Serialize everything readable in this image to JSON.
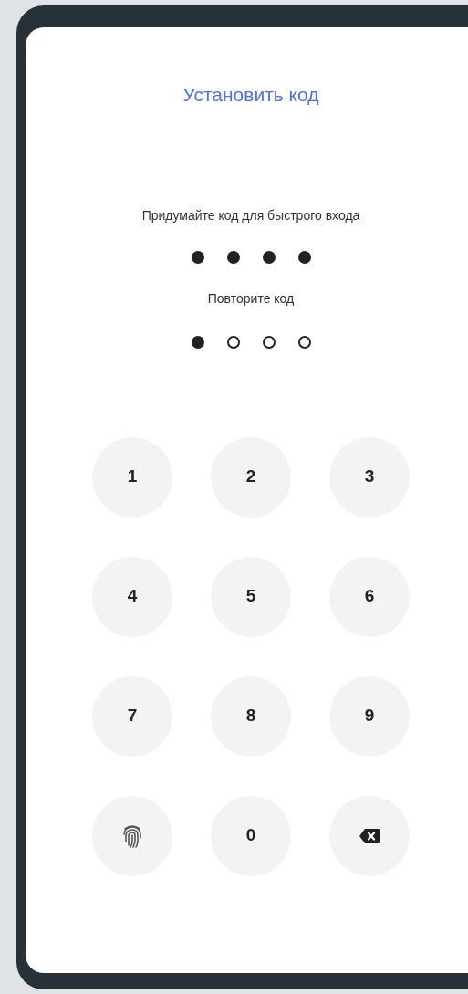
{
  "title": "Установить код",
  "create": {
    "prompt": "Придумайте код для быстрого входа",
    "dots": [
      {
        "filled": true
      },
      {
        "filled": true
      },
      {
        "filled": true
      },
      {
        "filled": true
      }
    ]
  },
  "repeat": {
    "prompt": "Повторите код",
    "dots": [
      {
        "filled": true
      },
      {
        "filled": false
      },
      {
        "filled": false
      },
      {
        "filled": false
      }
    ]
  },
  "keypad": [
    {
      "kind": "digit",
      "label": "1"
    },
    {
      "kind": "digit",
      "label": "2"
    },
    {
      "kind": "digit",
      "label": "3"
    },
    {
      "kind": "digit",
      "label": "4"
    },
    {
      "kind": "digit",
      "label": "5"
    },
    {
      "kind": "digit",
      "label": "6"
    },
    {
      "kind": "digit",
      "label": "7"
    },
    {
      "kind": "digit",
      "label": "8"
    },
    {
      "kind": "digit",
      "label": "9"
    },
    {
      "kind": "fingerprint"
    },
    {
      "kind": "digit",
      "label": "0"
    },
    {
      "kind": "backspace"
    }
  ]
}
